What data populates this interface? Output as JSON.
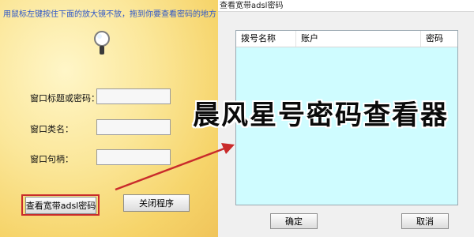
{
  "tool_window": {
    "hint": "用鼠标左键按住下面的放大镜不放，拖到你要查看密码的地方",
    "fields": [
      {
        "label": "窗口标题或密码：",
        "value": ""
      },
      {
        "label": "窗口类名：",
        "value": ""
      },
      {
        "label": "窗口句柄：",
        "value": ""
      }
    ],
    "buttons": {
      "view_password": "查看宽带adsl密码",
      "close_program": "关闭程序"
    },
    "icons": {
      "magnifier": "magnifier-icon"
    }
  },
  "dialog": {
    "title": "查看宽带adsl密码",
    "columns": [
      "拨号名称",
      "账户",
      "密码"
    ],
    "rows": [],
    "buttons": {
      "ok": "确定",
      "cancel": "取消"
    }
  },
  "overlay": {
    "title": "晨风星号密码查看器"
  },
  "colors": {
    "accent_red": "#c92b2b",
    "hint_blue": "#2d56c8",
    "list_bg": "#cffcff"
  }
}
